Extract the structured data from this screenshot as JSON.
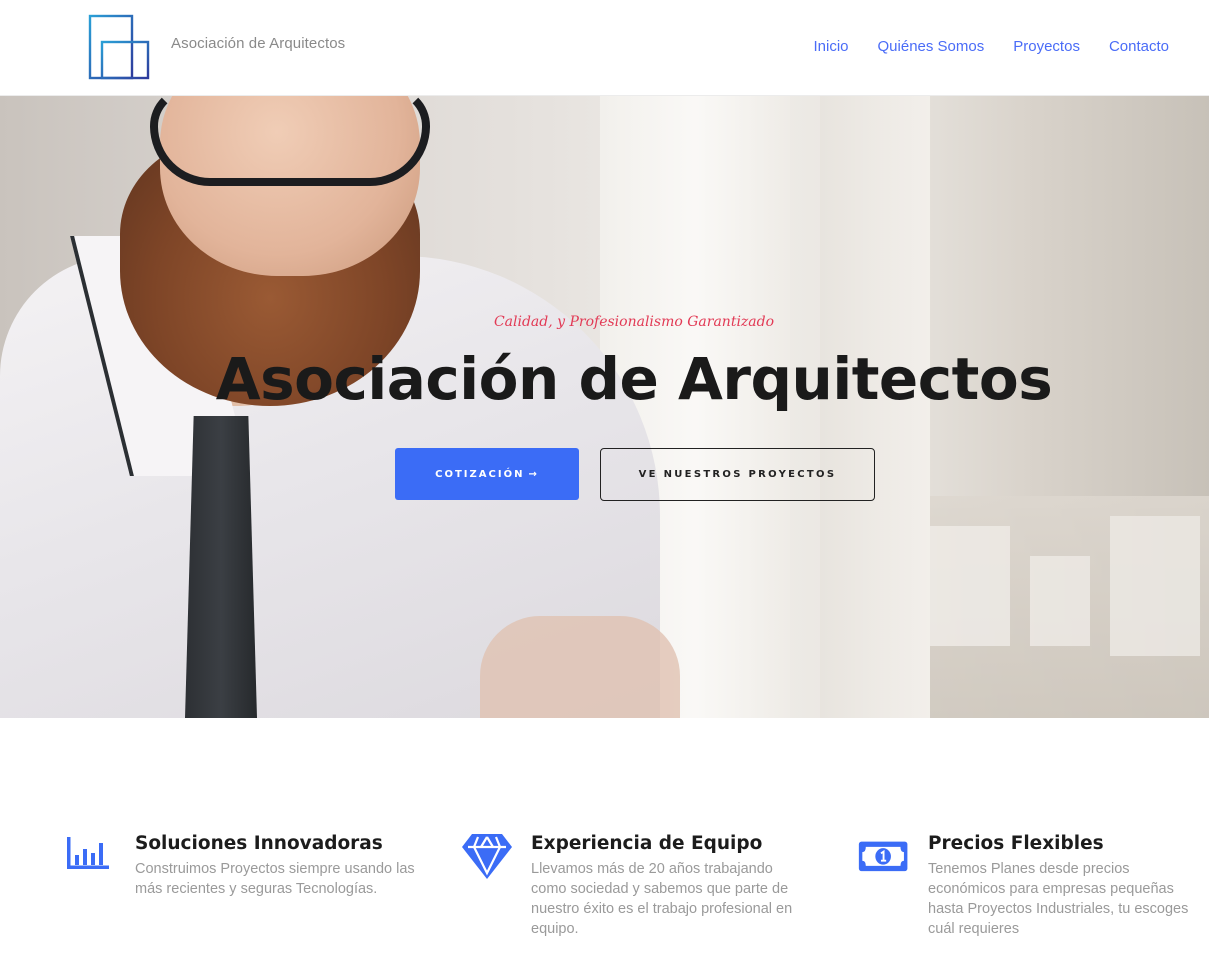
{
  "header": {
    "brand": "Asociación de Arquitectos",
    "nav": [
      "Inicio",
      "Quiénes Somos",
      "Proyectos",
      "Contacto"
    ]
  },
  "hero": {
    "tagline": "Calidad, y Profesionalismo Garantizado",
    "title": "Asociación de Arquitectos",
    "primary_button": "COTIZACIÓN",
    "primary_button_arrow": "→",
    "secondary_button": "VE NUESTROS PROYECTOS"
  },
  "features": [
    {
      "icon": "bar-chart-icon",
      "title": "Soluciones Innovadoras",
      "text": "Construimos Proyectos siempre usando las más recientes y seguras Tecnologías."
    },
    {
      "icon": "diamond-icon",
      "title": "Experiencia de Equipo",
      "text": "Llevamos más de 20 años trabajando como sociedad y sabemos que parte de nuestro éxito es el trabajo profesional en equipo."
    },
    {
      "icon": "money-bill-icon",
      "title": "Precios Flexibles",
      "text": "Tenemos Planes desde precios económicos para empresas pequeñas hasta Proyectos Industriales, tu escoges cuál requieres"
    }
  ],
  "colors": {
    "accent": "#3b6cf6",
    "nav_link": "#4a6cf7",
    "tagline": "#e23a55",
    "title": "#1a1a1a"
  }
}
